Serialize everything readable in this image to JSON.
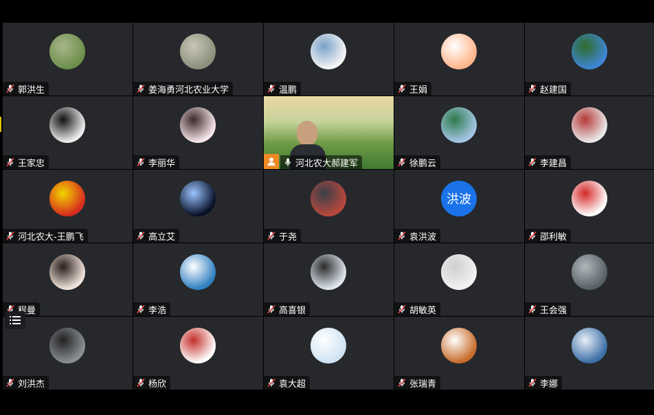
{
  "participants": [
    {
      "name": "郭洪生",
      "avatar_icon": "terraced-fields-photo",
      "colors": [
        "#6c8f4a",
        "#a7b58a"
      ]
    },
    {
      "name": "姜海勇河北农业大学",
      "avatar_icon": "branch-bird-photo",
      "colors": [
        "#8a8f7a",
        "#c9c7b6"
      ]
    },
    {
      "name": "温鹏",
      "avatar_icon": "cartoon-animals-icon",
      "colors": [
        "#f5f5f5",
        "#7aa0c8"
      ]
    },
    {
      "name": "王娟",
      "avatar_icon": "cartoon-bunny-icon",
      "colors": [
        "#ffb48a",
        "#ffffff"
      ]
    },
    {
      "name": "赵建国",
      "avatar_icon": "blue-sky-photo",
      "colors": [
        "#3f86d6",
        "#2f6b2b"
      ]
    },
    {
      "name": "王家忠",
      "avatar_icon": "running-figure-icon",
      "colors": [
        "#eeeeee",
        "#111111"
      ]
    },
    {
      "name": "李丽华",
      "avatar_icon": "cartoon-girl-icon",
      "colors": [
        "#f7e6ea",
        "#3b2a2a"
      ]
    },
    {
      "name": "河北农大郝建军",
      "avatar_icon": "video-feed",
      "colors": [
        "#cfd9a0",
        "#3f7a34"
      ],
      "is_video": true
    },
    {
      "name": "徐鹏云",
      "avatar_icon": "lighthouse-photo",
      "colors": [
        "#a4c6e6",
        "#2f7a4b"
      ]
    },
    {
      "name": "李建昌",
      "avatar_icon": "dessert-plate-photo",
      "colors": [
        "#e8e8e8",
        "#b53a3a"
      ]
    },
    {
      "name": "河北农大-王鹏飞",
      "avatar_icon": "china-flag-sphere",
      "colors": [
        "#d62a1f",
        "#f2d600"
      ]
    },
    {
      "name": "高立艾",
      "avatar_icon": "night-couple-photo",
      "colors": [
        "#071027",
        "#9bc4ff"
      ]
    },
    {
      "name": "于尧",
      "avatar_icon": "building-photo",
      "colors": [
        "#b8483d",
        "#3a3f4a"
      ]
    },
    {
      "name": "袁洪波",
      "avatar_icon": "text-avatar",
      "avatar_text": "洪波",
      "colors": [
        "#1a73e8",
        "#ffffff"
      ]
    },
    {
      "name": "邵利敏",
      "avatar_icon": "cartoon-sketch-icon",
      "colors": [
        "#ffffff",
        "#d42a2a"
      ]
    },
    {
      "name": "程曼",
      "avatar_icon": "woman-portrait-photo",
      "colors": [
        "#f0e4dc",
        "#2a1d1a"
      ]
    },
    {
      "name": "李浩",
      "avatar_icon": "blue-sea-photo",
      "colors": [
        "#2f7fc0",
        "#ffffff"
      ]
    },
    {
      "name": "高喜银",
      "avatar_icon": "dancers-photo",
      "colors": [
        "#dfe6ef",
        "#2c2c2c"
      ]
    },
    {
      "name": "胡敏英",
      "avatar_icon": "default-user-icon",
      "colors": [
        "#f2f2f2",
        "#cfcfcf"
      ]
    },
    {
      "name": "王会强",
      "avatar_icon": "office-interior-photo",
      "colors": [
        "#566066",
        "#b0b8bb"
      ]
    },
    {
      "name": "刘洪杰",
      "avatar_icon": "cartoon-man-glasses-icon",
      "colors": [
        "#8b8f94",
        "#222222"
      ]
    },
    {
      "name": "杨欣",
      "avatar_icon": "cartoon-car-icon",
      "colors": [
        "#ffffff",
        "#c4302b"
      ]
    },
    {
      "name": "袁大超",
      "avatar_icon": "girl-umbrella-photo",
      "colors": [
        "#cfe2f3",
        "#ffffff"
      ]
    },
    {
      "name": "张瑞青",
      "avatar_icon": "ghost-photo",
      "colors": [
        "#c76b2a",
        "#ffffff"
      ]
    },
    {
      "name": "李娜",
      "avatar_icon": "cloud-sky-photo",
      "colors": [
        "#3b6ea6",
        "#e8eef5"
      ]
    }
  ],
  "colors": {
    "background": "#000000",
    "tile": "#26282c",
    "active_speaker_border": "#38c172",
    "host_badge": "#f08a24"
  },
  "toolbar": {
    "list_icon": "list-menu-icon"
  }
}
